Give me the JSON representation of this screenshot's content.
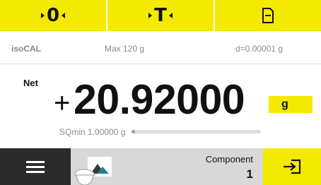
{
  "topbar": {
    "zero_label": "0",
    "tare_label": "T",
    "doc_icon": "document-icon"
  },
  "info": {
    "mode": "isoCAL",
    "max": "Max 120 g",
    "d": "d=0.00001 g"
  },
  "weight": {
    "net_label": "Net",
    "sign": "+",
    "value": "20.92000",
    "unit": "g"
  },
  "sqmin": {
    "label": "SQmin 1.00000 g",
    "progress": 0.0
  },
  "bottom": {
    "menu_icon": "hamburger-menu-icon",
    "app_icon": "weighing-application-icon",
    "component_label": "Component",
    "component_value": "1",
    "enter_icon": "enter-icon"
  },
  "colors": {
    "accent_yellow": "#f4ea00",
    "menu_dark": "#2b2b2b",
    "bottom_gray": "#d8d8d8"
  }
}
